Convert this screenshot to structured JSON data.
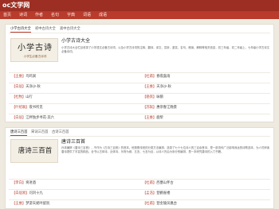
{
  "site": {
    "logo": "oc文学网"
  },
  "nav": [
    "首页",
    "诗词",
    "作者",
    "名句",
    "字典",
    "词语",
    "成语"
  ],
  "section1": {
    "tabs": [
      "小学古诗大全",
      "初中古诗大全",
      "高中古诗大全"
    ],
    "cover": {
      "title": "小学古诗",
      "subtitle": "小学生必备古诗词"
    },
    "book_title": "小学古诗大全",
    "book_desc": "小学古诗大全栏目收录了小学语文必备古诗词，以及小学古诗词的注释、翻译、译文、赏析、鉴赏、名句、朗读、解释等相关信息，初三年级、初二年级上、七年级小学古诗文必备诗词。",
    "rows": [
      [
        {
          "k": "【王维】",
          "v": "鸟鸣涧"
        },
        {
          "k": "【杜甫】",
          "v": "春夜喜雨"
        }
      ],
      [
        {
          "k": "【白居】",
          "v": "天净沙·秋"
        },
        {
          "k": "【王维】",
          "v": "天净沙·秋"
        }
      ],
      [
        {
          "k": "【杜牧】",
          "v": "山行"
        },
        {
          "k": "【骆宾】",
          "v": "咏鹅"
        }
      ],
      [
        {
          "k": "【叶绍翁】",
          "v": "夜书所见"
        },
        {
          "k": "【苏轼】",
          "v": "惠崇春江晚景"
        }
      ],
      [
        {
          "k": "【白居】",
          "v": "江畔独步寻花·其六"
        },
        {
          "k": "【王维】",
          "v": "鹿柴"
        }
      ]
    ]
  },
  "section2": {
    "tabs": [
      "唐诗三百首",
      "宋词三百首",
      "古诗三百首"
    ],
    "cover": {
      "title": "唐诗三百首"
    },
    "book_title": "唐诗三百首",
    "book_desc": "孙洙编撰《唐诗三百首》，不作为《古诗三百首》的底本。他按照传统的分类方法编排，选录了七十七位诗人的三百余首诗，是一部流传广泛影响深远的诗歌选本，为人们研读唐诗提供了丰富的精品。全书以古体诗、近体诗、乐府为纲，五言、七言为目，以诗人先后为序分别编排，是一本研究唐诗的入门书籍。",
    "rows": [
      [
        {
          "k": "【李白】",
          "v": "将进酒"
        },
        {
          "k": "【杜甫】",
          "v": "西塞山怀古"
        }
      ],
      [
        {
          "k": "【白居易】",
          "v": "问刘十九"
        },
        {
          "k": "【孟浩】",
          "v": "登鹳雀楼"
        }
      ],
      [
        {
          "k": "【王维】",
          "v": "梦游天姥吟留别"
        },
        {
          "k": "【杜甫】",
          "v": "登金陵凤凰台"
        }
      ]
    ]
  }
}
